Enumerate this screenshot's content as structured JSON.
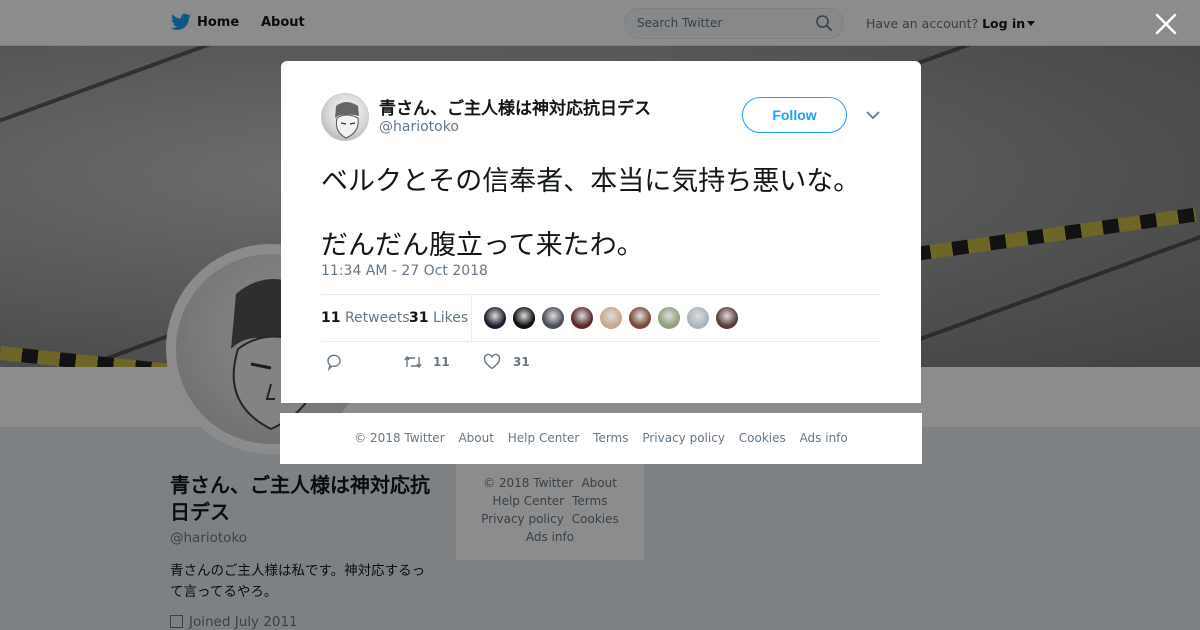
{
  "topbar": {
    "home_label": "Home",
    "about_label": "About",
    "search_placeholder": "Search Twitter",
    "account_prompt": "Have an account?",
    "login_label": "Log in"
  },
  "profile": {
    "name": "青さん、ご主人様は神対応抗日デス",
    "handle": "@hariotoko",
    "bio": "青さんのご主人様は私です。神対応するって言ってるやろ。",
    "joined": "Joined July 2011"
  },
  "side_footer": {
    "links": [
      "© 2018 Twitter",
      "About",
      "Help Center",
      "Terms",
      "Privacy policy",
      "Cookies",
      "Ads info"
    ]
  },
  "tweet": {
    "author_name": "青さん、ご主人様は神対応抗日デス",
    "author_handle": "@hariotoko",
    "follow_label": "Follow",
    "lines": [
      "ベルクとその信奉者、本当に気持ち悪いな。",
      "だんだん腹立って来たわ。"
    ],
    "timestamp": "11:34 AM - 27 Oct 2018",
    "retweets_count": "11",
    "retweets_label": "Retweets",
    "likes_count": "31",
    "likes_label": "Likes",
    "action_retweet_count": "11",
    "action_like_count": "31",
    "liker_avatars": [
      "#1c1c2a",
      "#0e0e0e",
      "#4a4f55",
      "#5a2a2a",
      "#c9a88a",
      "#7a4a3a",
      "#8fa07a",
      "#aab4c0",
      "#5a3a3a"
    ]
  },
  "modal_footer": {
    "links": [
      "© 2018 Twitter",
      "About",
      "Help Center",
      "Terms",
      "Privacy policy",
      "Cookies",
      "Ads info"
    ]
  },
  "colors": {
    "brand": "#1da1f2",
    "text_primary": "#14171a",
    "text_secondary": "#657786"
  }
}
